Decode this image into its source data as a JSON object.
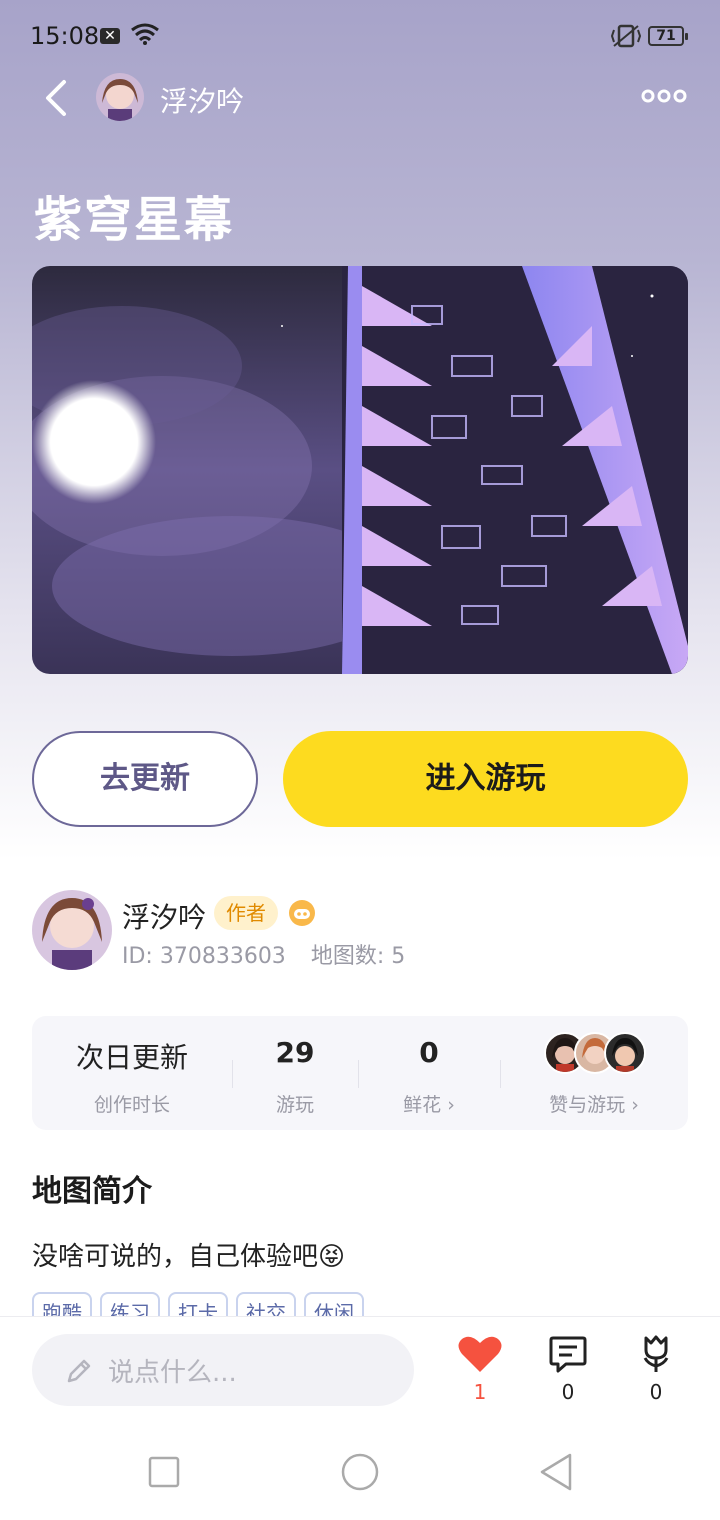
{
  "status_bar": {
    "time": "15:08",
    "battery": "71"
  },
  "header": {
    "username": "浮汐吟"
  },
  "map": {
    "title": "紫穹星幕"
  },
  "buttons": {
    "update": "去更新",
    "play": "进入游玩"
  },
  "author": {
    "name": "浮汐吟",
    "badge": "作者",
    "id": "ID: 370833603",
    "map_count": "地图数: 5"
  },
  "stats": {
    "duration_value": "次日更新",
    "duration_label": "创作时长",
    "plays_value": "29",
    "plays_label": "游玩",
    "flowers_value": "0",
    "flowers_label": "鲜花",
    "likes_label": "赞与游玩"
  },
  "intro": {
    "title": "地图简介",
    "text": "没啥可说的，自己体验吧😝"
  },
  "tags": [
    "跑酷",
    "练习",
    "打卡",
    "社交",
    "休闲"
  ],
  "bottom": {
    "comment_placeholder": "说点什么...",
    "like_count": "1",
    "comment_count": "0",
    "flower_count": "0"
  },
  "colors": {
    "accent_yellow": "#fddb1f",
    "like_red": "#f5523f",
    "purple_text": "#5e5887"
  }
}
